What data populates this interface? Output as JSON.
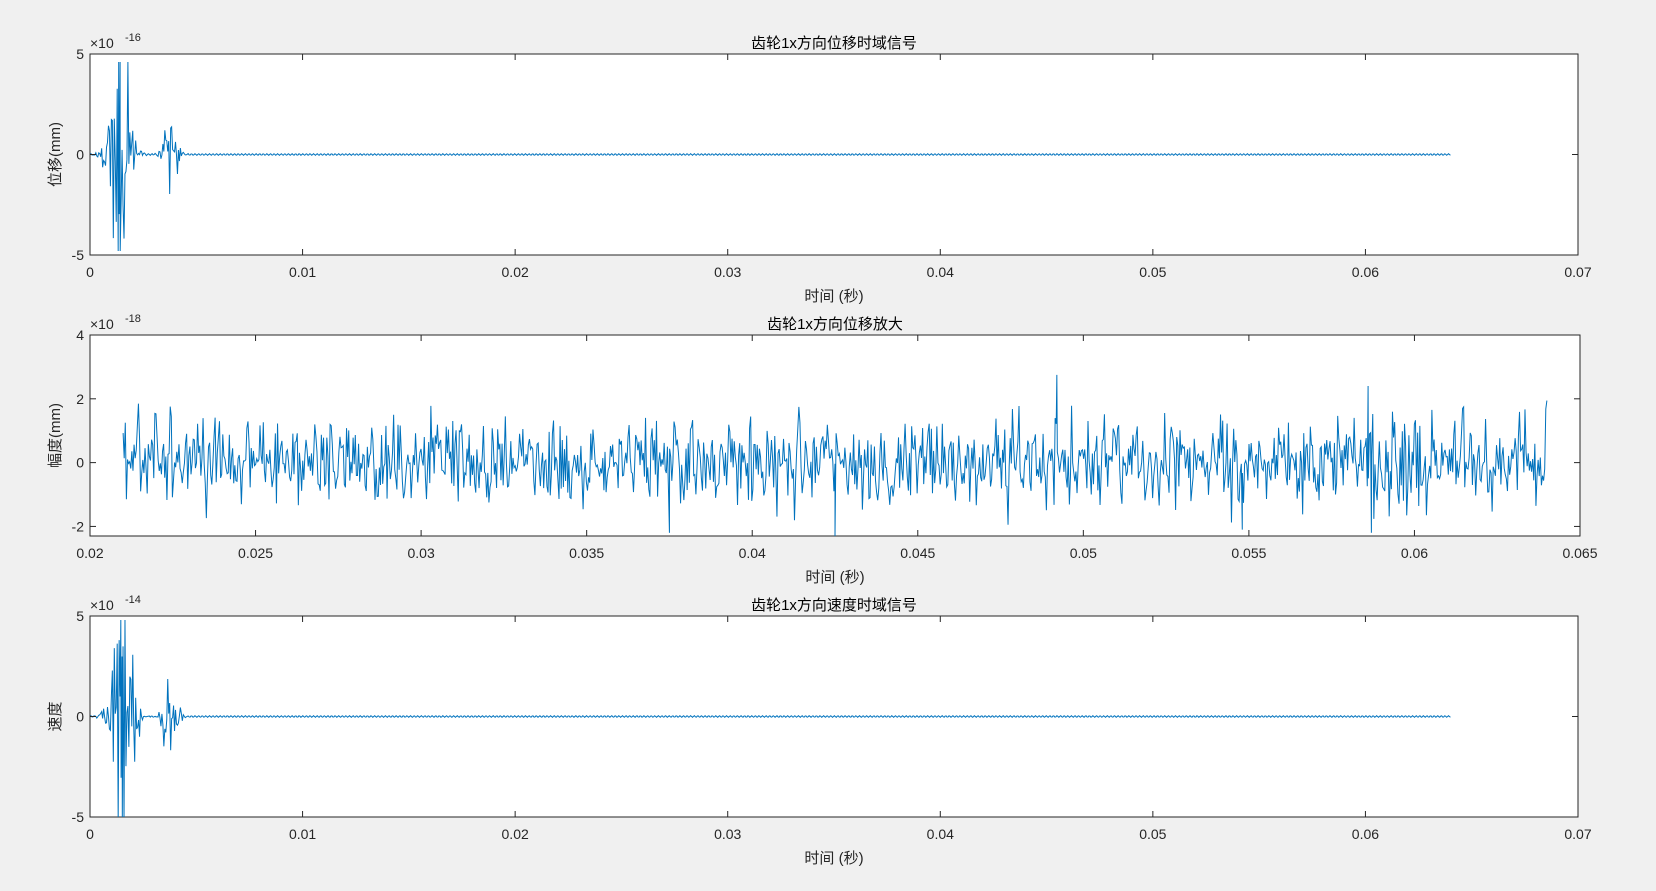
{
  "figure": {
    "background": "#f0f0f0",
    "line_color": "#0072bd",
    "axes_color": "#262626"
  },
  "chart_data": [
    {
      "type": "line",
      "title": "齿轮1x方向位移时域信号",
      "xlabel": "时间 (秒)",
      "ylabel": "位移(mm)",
      "exponent_base": "×10",
      "exponent_power": "-16",
      "xlim": [
        0,
        0.07
      ],
      "ylim": [
        -5,
        5
      ],
      "xticks": [
        0,
        0.01,
        0.02,
        0.03,
        0.04,
        0.05,
        0.06,
        0.07
      ],
      "xtick_labels": [
        "0",
        "0.01",
        "0.02",
        "0.03",
        "0.04",
        "0.05",
        "0.06",
        "0.07"
      ],
      "yticks": [
        -5,
        0,
        5
      ],
      "ytick_labels": [
        "-5",
        "0",
        "5"
      ],
      "grid": false,
      "series": [
        {
          "x_start": 0.0,
          "x_end": 0.064,
          "bursts": [
            {
              "center": 0.0014,
              "width": 0.0004,
              "amplitude": 4.6
            },
            {
              "center": 0.0038,
              "width": 0.00025,
              "amplitude": 1.7
            }
          ],
          "baseline_amplitude": 0.04,
          "approx_min": -4.8,
          "approx_max": 4.6
        }
      ]
    },
    {
      "type": "line",
      "title": "齿轮1x方向位移放大",
      "xlabel": "时间 (秒)",
      "ylabel": "幅度(mm)",
      "exponent_base": "×10",
      "exponent_power": "-18",
      "xlim": [
        0.02,
        0.065
      ],
      "ylim": [
        -2.3,
        4
      ],
      "xticks": [
        0.02,
        0.025,
        0.03,
        0.035,
        0.04,
        0.045,
        0.05,
        0.055,
        0.06,
        0.065
      ],
      "xtick_labels": [
        "0.02",
        "0.025",
        "0.03",
        "0.035",
        "0.04",
        "0.045",
        "0.05",
        "0.055",
        "0.06",
        "0.065"
      ],
      "yticks": [
        -2,
        0,
        2,
        4
      ],
      "ytick_labels": [
        "-2",
        "0",
        "2",
        "4"
      ],
      "grid": false,
      "series": [
        {
          "x_start": 0.021,
          "x_end": 0.064,
          "noise_std": 0.65,
          "approx_min": -2.3,
          "approx_max": 2.7,
          "peaks": [
            {
              "x": 0.0492,
              "y": 2.75
            },
            {
              "x": 0.0586,
              "y": 2.4
            },
            {
              "x": 0.0425,
              "y": -2.3
            },
            {
              "x": 0.0375,
              "y": -2.2
            },
            {
              "x": 0.0587,
              "y": -2.2
            },
            {
              "x": 0.0548,
              "y": -2.1
            }
          ]
        }
      ]
    },
    {
      "type": "line",
      "title": "齿轮1x方向速度时域信号",
      "xlabel": "时间 (秒)",
      "ylabel": "速度",
      "exponent_base": "×10",
      "exponent_power": "-14",
      "xlim": [
        0,
        0.07
      ],
      "ylim": [
        -5,
        5
      ],
      "xticks": [
        0,
        0.01,
        0.02,
        0.03,
        0.04,
        0.05,
        0.06,
        0.07
      ],
      "xtick_labels": [
        "0",
        "0.01",
        "0.02",
        "0.03",
        "0.04",
        "0.05",
        "0.06",
        "0.07"
      ],
      "yticks": [
        -5,
        0,
        5
      ],
      "ytick_labels": [
        "-5",
        "0",
        "5"
      ],
      "grid": false,
      "series": [
        {
          "x_start": 0.0,
          "x_end": 0.064,
          "bursts": [
            {
              "center": 0.0015,
              "width": 0.0004,
              "amplitude": 4.8
            },
            {
              "center": 0.0038,
              "width": 0.00025,
              "amplitude": 1.9
            }
          ],
          "baseline_amplitude": 0.04,
          "approx_min": -5.2,
          "approx_max": 4.8
        }
      ]
    }
  ]
}
